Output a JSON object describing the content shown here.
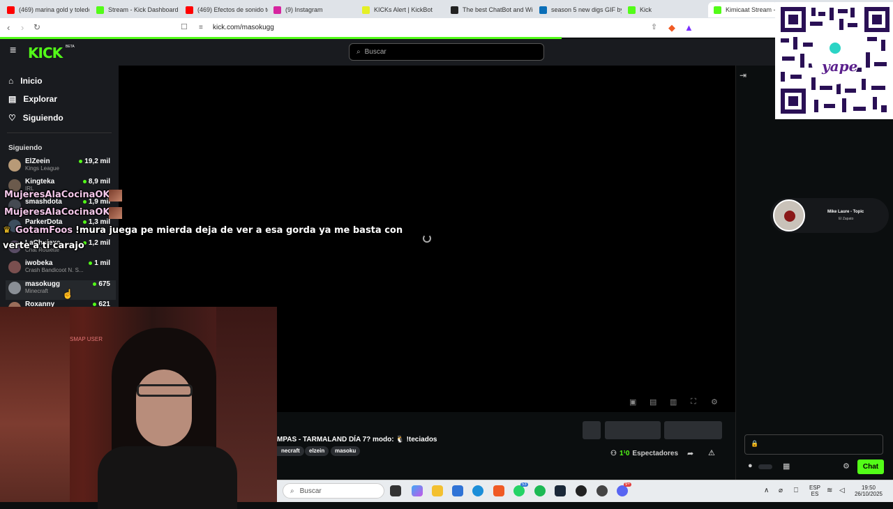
{
  "browser": {
    "tabs": [
      {
        "label": "(469) marina gold y toledo",
        "color": "#ff0000"
      },
      {
        "label": "Stream - Kick Dashboard",
        "color": "#53fc18"
      },
      {
        "label": "(469) Efectos de sonido te",
        "color": "#ff0000"
      },
      {
        "label": "(9) Instagram",
        "color": "#d6249f"
      },
      {
        "label": "KICKs Alert | KickBot",
        "color": "#e5f026"
      },
      {
        "label": "The best ChatBot and Wid",
        "color": "#222222"
      },
      {
        "label": "season 5 new digs GIF by",
        "color": "#0b6fb8"
      },
      {
        "label": "Kick",
        "color": "#53fc18"
      },
      {
        "label": "Kimicaat Stream - W",
        "color": "#53fc18"
      }
    ],
    "url": "kick.com/masokugg"
  },
  "kick": {
    "logo": "KICK",
    "beta": "BETA",
    "search_placeholder": "Buscar",
    "nav": {
      "inicio": "Inicio",
      "explorar": "Explorar",
      "siguiendo": "Siguiendo"
    },
    "following_header": "Siguiendo",
    "channels": [
      {
        "name": "ElZeein",
        "category": "Kings League",
        "viewers": "19,2 mil"
      },
      {
        "name": "Kingteka",
        "category": "IRL",
        "viewers": "8,9 mil"
      },
      {
        "name": "smashdota",
        "category": "",
        "viewers": "1,9 mil"
      },
      {
        "name": "ParkerDota",
        "category": "",
        "viewers": "1,3 mil"
      },
      {
        "name": "LaCholexe",
        "category": "Chat Roulette",
        "viewers": "1,2 mil"
      },
      {
        "name": "iwobeka",
        "category": "Crash Bandicoot N. S...",
        "viewers": "1 mil"
      },
      {
        "name": "masokugg",
        "category": "Minecraft",
        "viewers": "675"
      },
      {
        "name": "Roxanny",
        "category": "",
        "viewers": "621"
      }
    ],
    "stream": {
      "title": "MPAS - TARMALAND DÍA 7? modo: 🐧 !teciados",
      "tags": [
        "necraft",
        "elzein",
        "masoku"
      ],
      "viewers_label": "Espectadores",
      "viewers_value": "1¹0"
    },
    "chat": {
      "send_label": "Chat"
    }
  },
  "overlays": {
    "chat_lines": [
      {
        "user": "MujeresAlaCocinaOK :",
        "message": ""
      },
      {
        "user": "MujeresAlaCocinaOK :",
        "message": ""
      },
      {
        "user": "GotamFoos :",
        "message": "!mura juega pe mierda deja de ver a esa gorda ya me basta con"
      },
      {
        "user": "",
        "message": "verte a ti carajo"
      }
    ],
    "qr_brand": "yape",
    "music": {
      "title": "Mike Laure - Topic",
      "subtitle": "El Zapato"
    },
    "cam_text": "SMAP USER"
  },
  "taskbar": {
    "search_placeholder": "Buscar",
    "lang_top": "ESP",
    "lang_bottom": "ES",
    "time": "19:50",
    "date": "26/10/2025",
    "badges": {
      "whatsapp": "53",
      "discord": "9+"
    }
  }
}
